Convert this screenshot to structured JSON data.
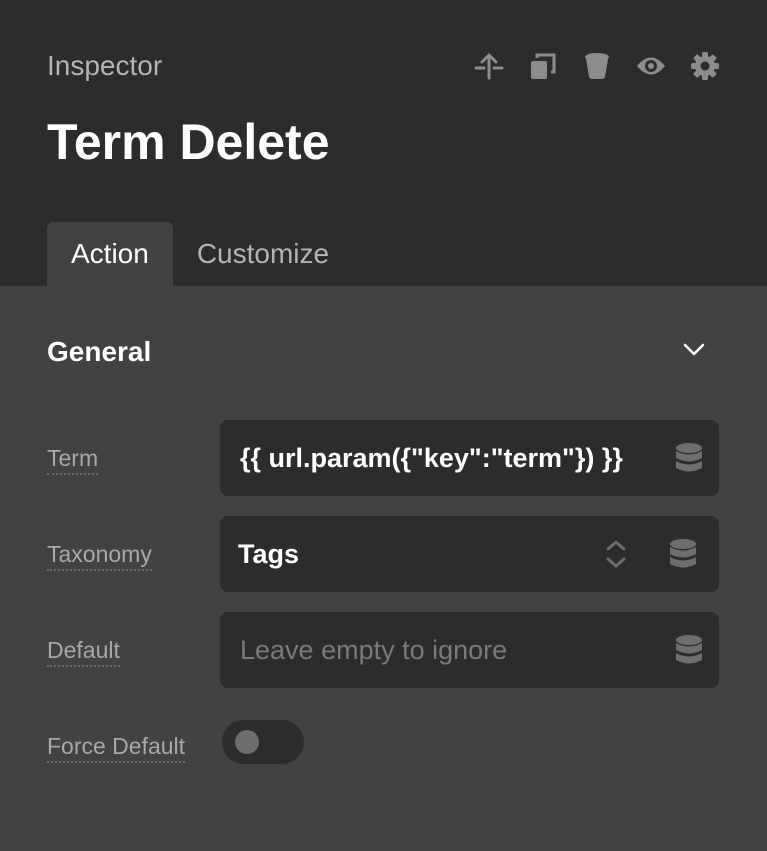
{
  "header": {
    "panel_title": "Inspector",
    "title": "Term Delete",
    "toolbar": [
      {
        "icon": "move-up-icon"
      },
      {
        "icon": "duplicate-icon"
      },
      {
        "icon": "trash-icon"
      },
      {
        "icon": "eye-icon"
      },
      {
        "icon": "gear-icon"
      }
    ]
  },
  "tabs": [
    {
      "label": "Action",
      "active": true
    },
    {
      "label": "Customize",
      "active": false
    }
  ],
  "section": {
    "title": "General",
    "expanded": true
  },
  "fields": {
    "term": {
      "label": "Term",
      "value": "{{ url.param({\"key\":\"term\"}) }}"
    },
    "taxonomy": {
      "label": "Taxonomy",
      "value": "Tags"
    },
    "default": {
      "label": "Default",
      "placeholder": "Leave empty to ignore",
      "value": ""
    },
    "force_default": {
      "label": "Force Default",
      "enabled": false
    }
  },
  "colors": {
    "header_bg": "#2c2c2c",
    "panel_bg": "#424242",
    "field_bg": "#2c2c2c",
    "text_primary": "#ffffff",
    "text_muted": "#a8a8a8"
  }
}
